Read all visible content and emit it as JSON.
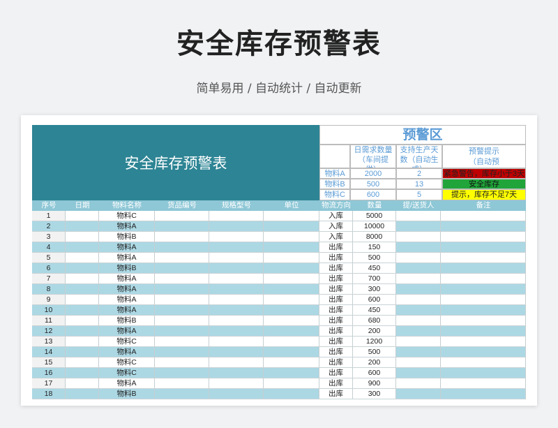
{
  "page": {
    "title": "安全库存预警表",
    "subtitle": "简单易用  /  自动统计  /  自动更新"
  },
  "sheet": {
    "banner_title": "安全库存预警表",
    "warning_zone": {
      "title": "预警区",
      "col_headers": [
        "日需求数量（车间提供）",
        "支持生产天数（自动生成）",
        "预警提示（自动预警）"
      ],
      "rows": [
        {
          "item": "物料A",
          "demand": "2000",
          "days": "2",
          "hint": "紧急警告，库存小于3天",
          "status": "red"
        },
        {
          "item": "物料B",
          "demand": "500",
          "days": "13",
          "hint": "安全库存",
          "status": "green"
        },
        {
          "item": "物料C",
          "demand": "600",
          "days": "5",
          "hint": "提示，库存不足7天",
          "status": "yellow"
        }
      ]
    },
    "columns": [
      "序号",
      "日期",
      "物料名称",
      "货品编号",
      "规格型号",
      "单位",
      "物流方向",
      "数量",
      "提/送货人",
      "备注"
    ],
    "rows": [
      [
        "1",
        "",
        "物料C",
        "",
        "",
        "",
        "入库",
        "5000",
        "",
        ""
      ],
      [
        "2",
        "",
        "物料A",
        "",
        "",
        "",
        "入库",
        "10000",
        "",
        ""
      ],
      [
        "3",
        "",
        "物料B",
        "",
        "",
        "",
        "入库",
        "8000",
        "",
        ""
      ],
      [
        "4",
        "",
        "物料A",
        "",
        "",
        "",
        "出库",
        "150",
        "",
        ""
      ],
      [
        "5",
        "",
        "物料A",
        "",
        "",
        "",
        "出库",
        "500",
        "",
        ""
      ],
      [
        "6",
        "",
        "物料B",
        "",
        "",
        "",
        "出库",
        "450",
        "",
        ""
      ],
      [
        "7",
        "",
        "物料A",
        "",
        "",
        "",
        "出库",
        "700",
        "",
        ""
      ],
      [
        "8",
        "",
        "物料A",
        "",
        "",
        "",
        "出库",
        "300",
        "",
        ""
      ],
      [
        "9",
        "",
        "物料A",
        "",
        "",
        "",
        "出库",
        "600",
        "",
        ""
      ],
      [
        "10",
        "",
        "物料A",
        "",
        "",
        "",
        "出库",
        "450",
        "",
        ""
      ],
      [
        "11",
        "",
        "物料B",
        "",
        "",
        "",
        "出库",
        "680",
        "",
        ""
      ],
      [
        "12",
        "",
        "物料A",
        "",
        "",
        "",
        "出库",
        "200",
        "",
        ""
      ],
      [
        "13",
        "",
        "物料C",
        "",
        "",
        "",
        "出库",
        "1200",
        "",
        ""
      ],
      [
        "14",
        "",
        "物料A",
        "",
        "",
        "",
        "出库",
        "500",
        "",
        ""
      ],
      [
        "15",
        "",
        "物料C",
        "",
        "",
        "",
        "出库",
        "200",
        "",
        ""
      ],
      [
        "16",
        "",
        "物料C",
        "",
        "",
        "",
        "出库",
        "600",
        "",
        ""
      ],
      [
        "17",
        "",
        "物料A",
        "",
        "",
        "",
        "出库",
        "900",
        "",
        ""
      ],
      [
        "18",
        "",
        "物料B",
        "",
        "",
        "",
        "出库",
        "300",
        "",
        ""
      ]
    ]
  },
  "colors": {
    "banner": "#2d8494",
    "header_row": "#8ec7d6",
    "band_light": "#f2f2f2",
    "band_blue": "#acd8e4",
    "warn_text": "#5b9bd5",
    "status_red": "#c00000",
    "status_green": "#21a53a",
    "status_yellow": "#ffff00"
  }
}
